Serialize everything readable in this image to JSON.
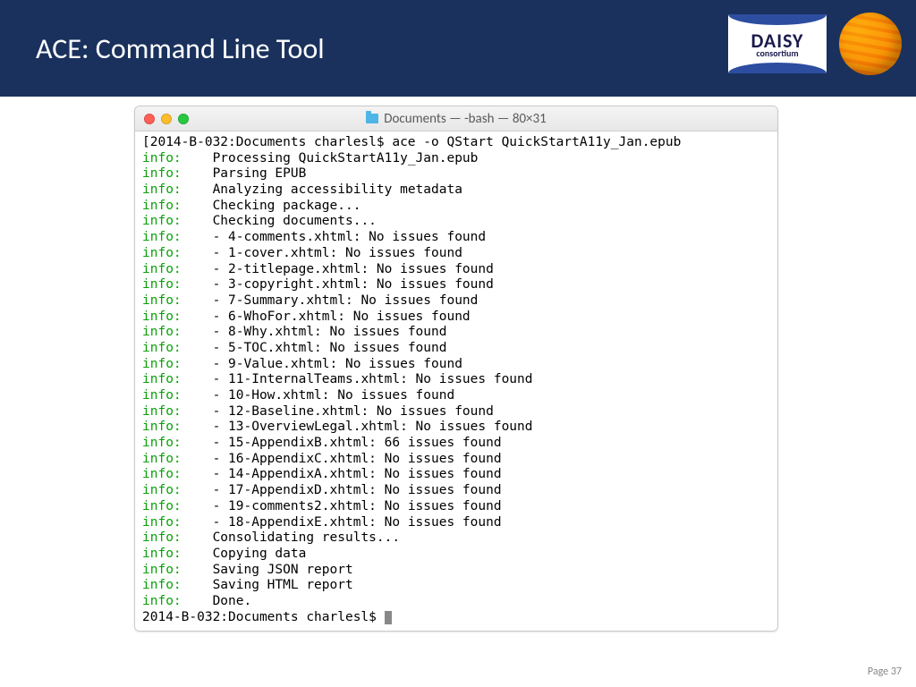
{
  "header": {
    "title": "ACE: Command Line Tool"
  },
  "logos": {
    "daisy_line1": "DAISY",
    "daisy_line2": "consortium"
  },
  "terminal": {
    "window_title": "Documents — -bash — 80×31",
    "prompt_prefix": "2014-B-032:Documents charlesl$",
    "command": "ace -o QStart QuickStartA11y_Jan.epub",
    "lines": [
      {
        "level": "info:",
        "text": "Processing QuickStartA11y_Jan.epub"
      },
      {
        "level": "info:",
        "text": "Parsing EPUB"
      },
      {
        "level": "info:",
        "text": "Analyzing accessibility metadata"
      },
      {
        "level": "info:",
        "text": "Checking package..."
      },
      {
        "level": "info:",
        "text": "Checking documents..."
      },
      {
        "level": "info:",
        "text": "- 4-comments.xhtml: No issues found"
      },
      {
        "level": "info:",
        "text": "- 1-cover.xhtml: No issues found"
      },
      {
        "level": "info:",
        "text": "- 2-titlepage.xhtml: No issues found"
      },
      {
        "level": "info:",
        "text": "- 3-copyright.xhtml: No issues found"
      },
      {
        "level": "info:",
        "text": "- 7-Summary.xhtml: No issues found"
      },
      {
        "level": "info:",
        "text": "- 6-WhoFor.xhtml: No issues found"
      },
      {
        "level": "info:",
        "text": "- 8-Why.xhtml: No issues found"
      },
      {
        "level": "info:",
        "text": "- 5-TOC.xhtml: No issues found"
      },
      {
        "level": "info:",
        "text": "- 9-Value.xhtml: No issues found"
      },
      {
        "level": "info:",
        "text": "- 11-InternalTeams.xhtml: No issues found"
      },
      {
        "level": "info:",
        "text": "- 10-How.xhtml: No issues found"
      },
      {
        "level": "info:",
        "text": "- 12-Baseline.xhtml: No issues found"
      },
      {
        "level": "info:",
        "text": "- 13-OverviewLegal.xhtml: No issues found"
      },
      {
        "level": "info:",
        "text": "- 15-AppendixB.xhtml: 66 issues found"
      },
      {
        "level": "info:",
        "text": "- 16-AppendixC.xhtml: No issues found"
      },
      {
        "level": "info:",
        "text": "- 14-AppendixA.xhtml: No issues found"
      },
      {
        "level": "info:",
        "text": "- 17-AppendixD.xhtml: No issues found"
      },
      {
        "level": "info:",
        "text": "- 19-comments2.xhtml: No issues found"
      },
      {
        "level": "info:",
        "text": "- 18-AppendixE.xhtml: No issues found"
      },
      {
        "level": "info:",
        "text": "Consolidating results..."
      },
      {
        "level": "info:",
        "text": "Copying data"
      },
      {
        "level": "info:",
        "text": "Saving JSON report"
      },
      {
        "level": "info:",
        "text": "Saving HTML report"
      },
      {
        "level": "info:",
        "text": "Done."
      }
    ],
    "final_prompt": "2014-B-032:Documents charlesl$"
  },
  "footer": {
    "page_label": "Page 37"
  }
}
